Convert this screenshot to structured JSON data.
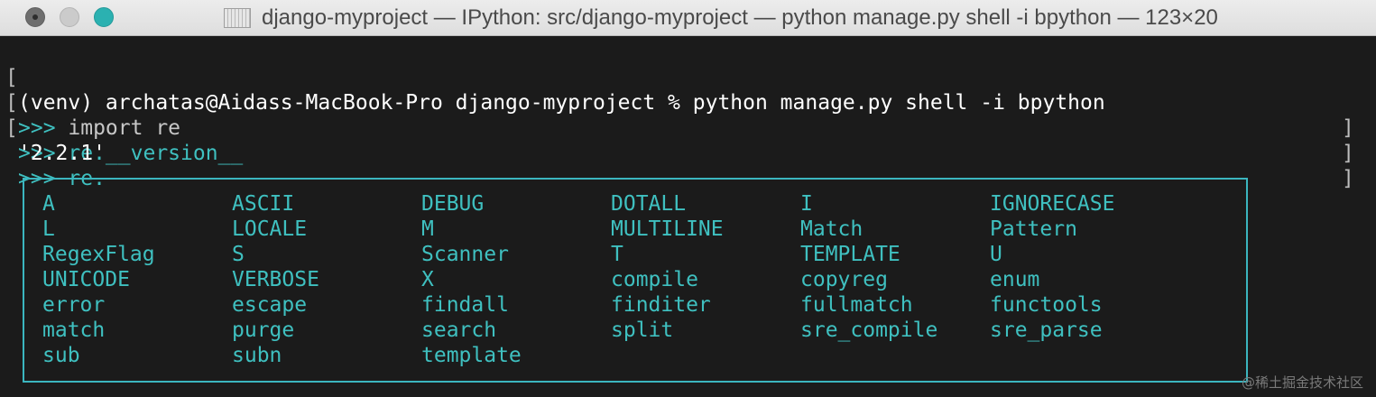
{
  "window": {
    "title": "django-myproject — IPython: src/django-myproject — python manage.py shell -i bpython — 123×20",
    "traffic_light_colors": {
      "close": "#6e6e6e",
      "minimize": "#cbcbcb",
      "maximize": "#2bb1b1"
    }
  },
  "terminal": {
    "lines": [
      {
        "bracket": "[",
        "prompt": "",
        "text": "(venv) archatas@Aidass-MacBook-Pro django-myproject % python manage.py shell -i bpython",
        "end": "]"
      },
      {
        "bracket": "[",
        "prompt": ">>> ",
        "text": "import re",
        "end": "]"
      },
      {
        "bracket": "[",
        "prompt": ">>> ",
        "text": "re.__version__",
        "end": "]"
      },
      {
        "bracket": "",
        "prompt": "",
        "text": "'2.2.1'",
        "end": ""
      },
      {
        "bracket": "",
        "prompt": ">>> ",
        "text": "re.",
        "end": ""
      }
    ],
    "completions": [
      [
        "A",
        "ASCII",
        "DEBUG",
        "DOTALL",
        "I",
        "IGNORECASE"
      ],
      [
        "L",
        "LOCALE",
        "M",
        "MULTILINE",
        "Match",
        "Pattern"
      ],
      [
        "RegexFlag",
        "S",
        "Scanner",
        "T",
        "TEMPLATE",
        "U"
      ],
      [
        "UNICODE",
        "VERBOSE",
        "X",
        "compile",
        "copyreg",
        "enum"
      ],
      [
        "error",
        "escape",
        "findall",
        "finditer",
        "fullmatch",
        "functools"
      ],
      [
        "match",
        "purge",
        "search",
        "split",
        "sre_compile",
        "sre_parse"
      ],
      [
        "sub",
        "subn",
        "template"
      ]
    ],
    "colors": {
      "background": "#1b1b1b",
      "prompt": "#3fc0c0",
      "text": "#ffffff",
      "completion": "#3fc0c0",
      "box_border": "#3bb6bf"
    }
  },
  "watermark": "@稀土掘金技术社区"
}
